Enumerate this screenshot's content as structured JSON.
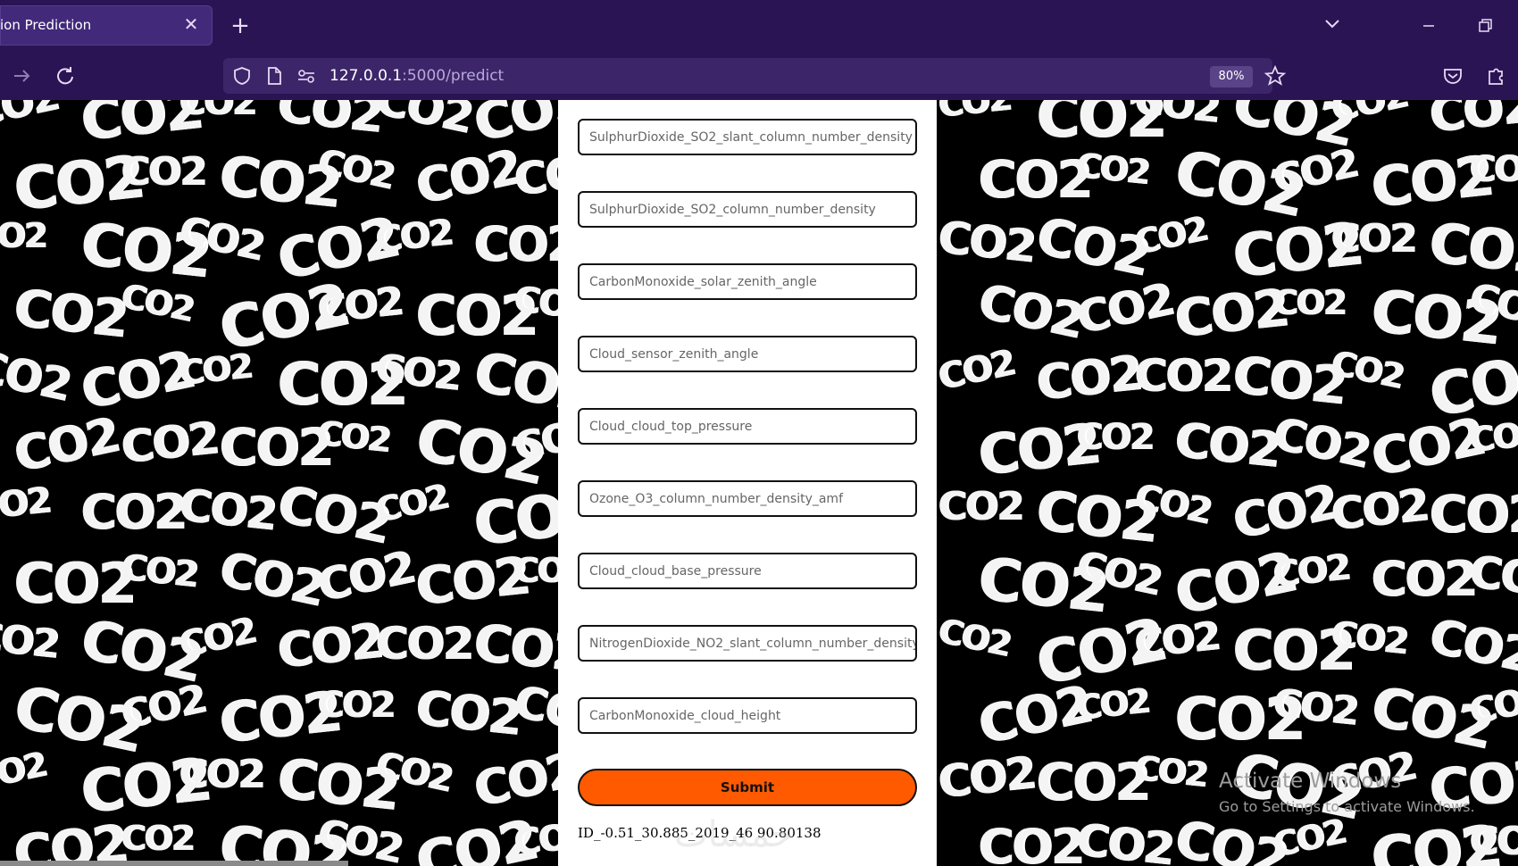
{
  "browser": {
    "tab_title": "ion Prediction",
    "url_host": "127.0.0.1",
    "url_rest": ":5000/predict",
    "zoom": "80%"
  },
  "background": {
    "word": "CO2"
  },
  "form": {
    "fields": [
      {
        "placeholder": "SulphurDioxide_SO2_slant_column_number_density"
      },
      {
        "placeholder": "SulphurDioxide_SO2_column_number_density"
      },
      {
        "placeholder": "CarbonMonoxide_solar_zenith_angle"
      },
      {
        "placeholder": "Cloud_sensor_zenith_angle"
      },
      {
        "placeholder": "Cloud_cloud_top_pressure"
      },
      {
        "placeholder": "Ozone_O3_column_number_density_amf"
      },
      {
        "placeholder": "Cloud_cloud_base_pressure"
      },
      {
        "placeholder": "NitrogenDioxide_NO2_slant_column_number_density"
      },
      {
        "placeholder": "CarbonMonoxide_cloud_height"
      }
    ],
    "submit_label": "Submit",
    "result": "ID_-0.51_30.885_2019_46 90.80138"
  },
  "system": {
    "activate_title": "Activate Windows",
    "activate_sub": "Go to Settings to activate Windows.",
    "watermark": "خمسات"
  },
  "colors": {
    "chrome": "#2b1454",
    "submit": "#ff5a00"
  }
}
